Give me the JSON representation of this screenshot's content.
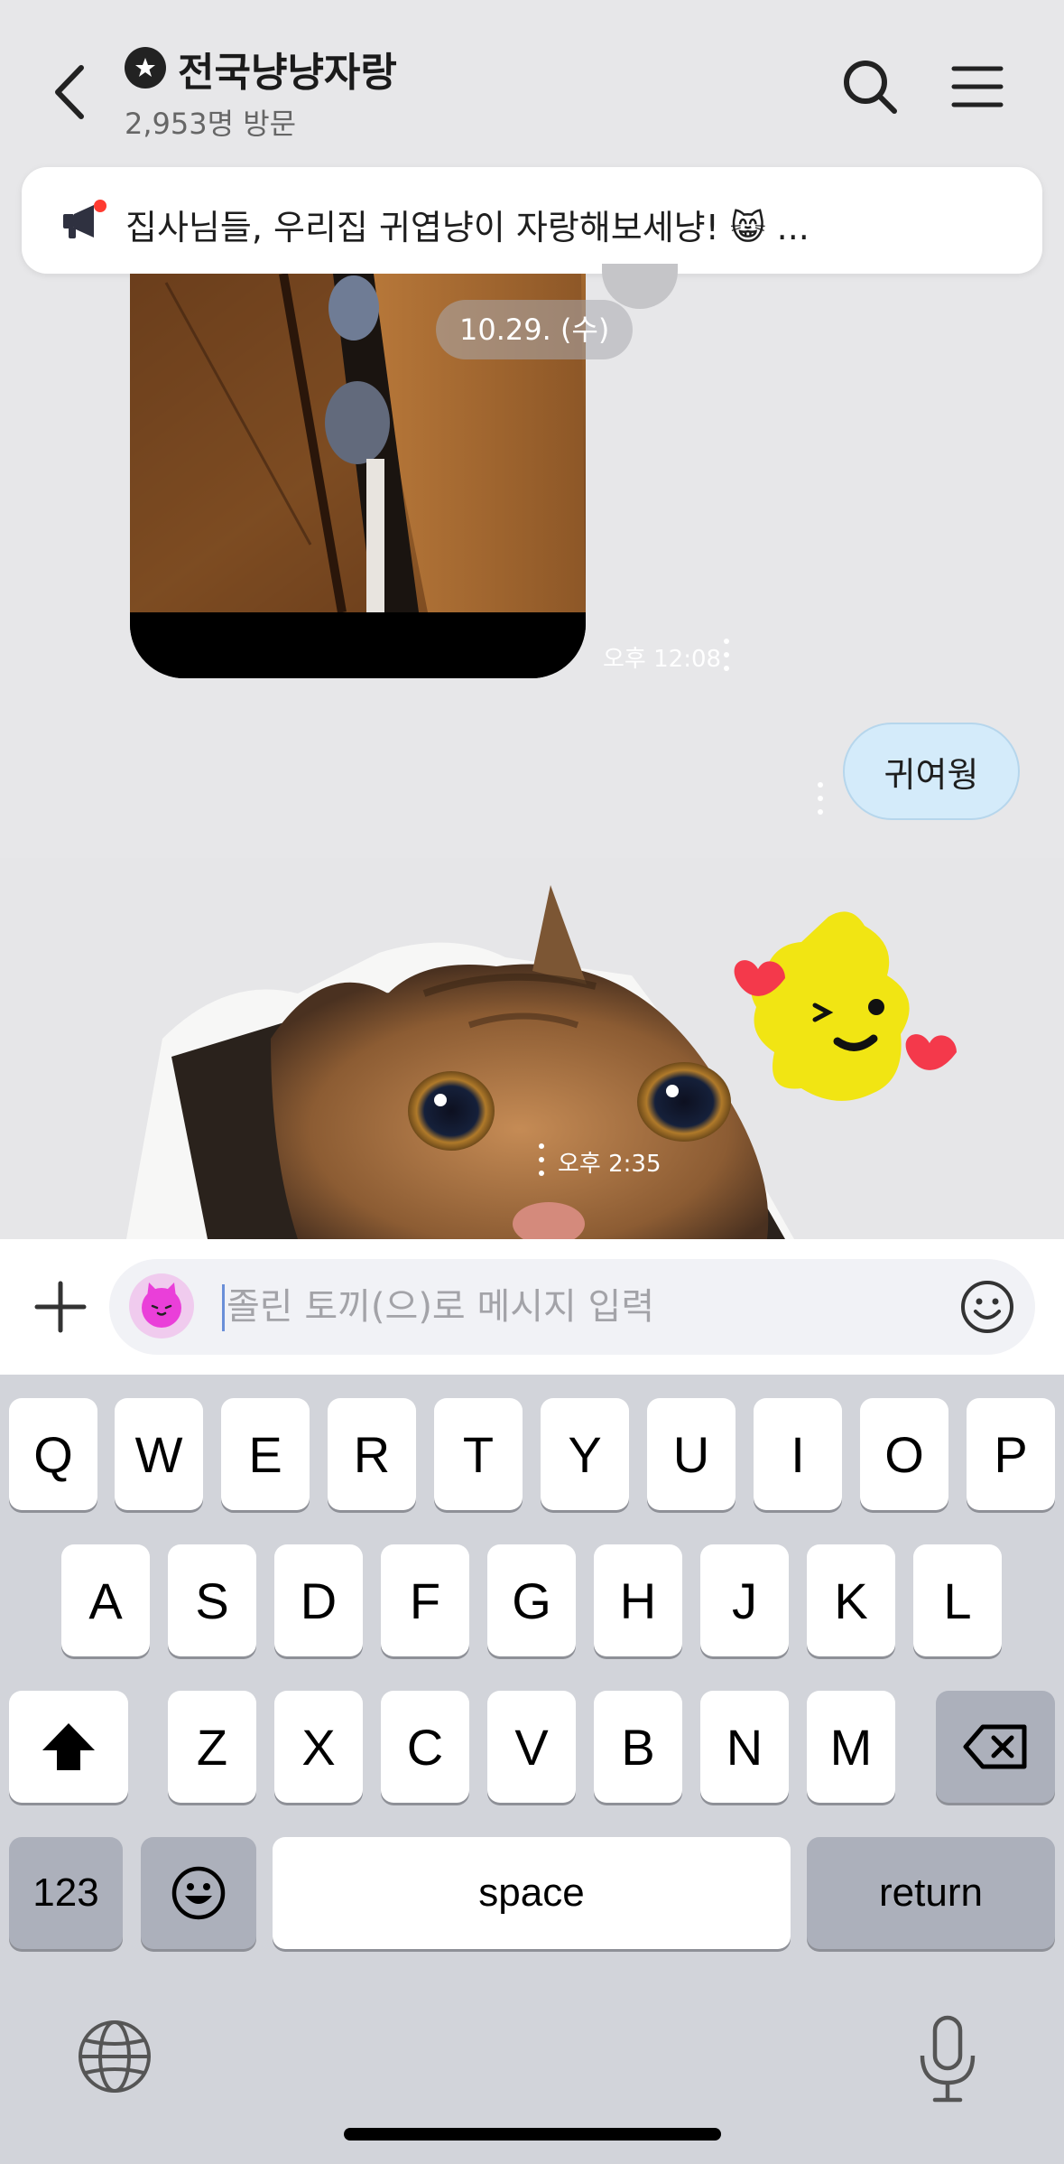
{
  "header": {
    "title": "전국냥냥자랑",
    "subtitle": "2,953명 방문"
  },
  "notice": {
    "text": "집사님들, 우리집 귀엽냥이 자랑해보세냥! 😸 ..."
  },
  "chat": {
    "date_chip": "10.29. (수)",
    "messages": [
      {
        "type": "photo",
        "sender": "other",
        "time": "오후 12:08"
      },
      {
        "type": "text",
        "sender": "me",
        "text": "귀여웡"
      },
      {
        "type": "photo",
        "sender": "other",
        "time": "오후 2:35"
      }
    ]
  },
  "input": {
    "placeholder": "졸린 토끼(으)로 메시지 입력",
    "value": ""
  },
  "keyboard": {
    "row1": [
      "Q",
      "W",
      "E",
      "R",
      "T",
      "Y",
      "U",
      "I",
      "O",
      "P"
    ],
    "row2": [
      "A",
      "S",
      "D",
      "F",
      "G",
      "H",
      "J",
      "K",
      "L"
    ],
    "row3": [
      "Z",
      "X",
      "C",
      "V",
      "B",
      "N",
      "M"
    ],
    "numbers_key": "123",
    "space_key": "space",
    "return_key": "return"
  },
  "colors": {
    "background": "#e7e7e9",
    "my_bubble": "#d4ebfa",
    "keyboard_bg": "#d2d4da",
    "notice_dot": "#ff3b30",
    "sticker_yellow": "#f1e513",
    "sticker_heart": "#f4394b"
  },
  "icons": [
    "back-arrow-icon",
    "chat-room-badge-icon",
    "search-icon",
    "hamburger-menu-icon",
    "megaphone-icon",
    "plus-icon",
    "profile-avatar",
    "emoji-icon",
    "shift-icon",
    "backspace-icon",
    "emoji-keyboard-icon",
    "globe-icon",
    "microphone-icon"
  ]
}
